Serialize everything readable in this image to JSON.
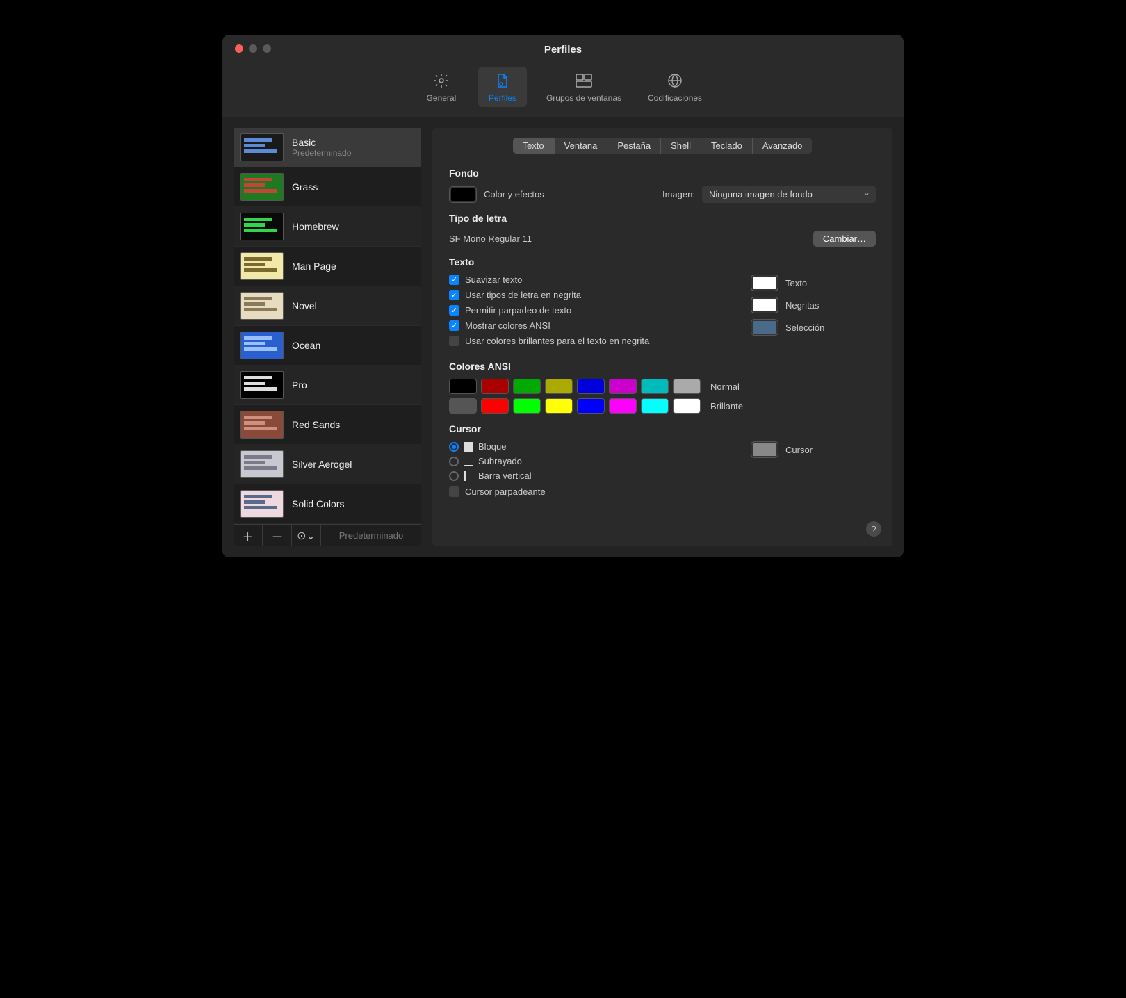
{
  "window": {
    "title": "Perfiles"
  },
  "toolbar": {
    "items": [
      {
        "label": "General"
      },
      {
        "label": "Perfiles"
      },
      {
        "label": "Grupos de ventanas"
      },
      {
        "label": "Codificaciones"
      }
    ],
    "active": 1
  },
  "sidebar": {
    "profiles": [
      {
        "name": "Basic",
        "sub": "Predeterminado",
        "bg": "#1a1a1a",
        "fg": "#5b8bd4"
      },
      {
        "name": "Grass",
        "bg": "#1f7a1f",
        "fg": "#c4443c"
      },
      {
        "name": "Homebrew",
        "bg": "#0a0a0a",
        "fg": "#2fd84a"
      },
      {
        "name": "Man Page",
        "bg": "#f2e9a8",
        "fg": "#7a6a2e"
      },
      {
        "name": "Novel",
        "bg": "#e8dcc0",
        "fg": "#8a7a5a"
      },
      {
        "name": "Ocean",
        "bg": "#2a5fd0",
        "fg": "#9ac0ff"
      },
      {
        "name": "Pro",
        "bg": "#000000",
        "fg": "#dddddd"
      },
      {
        "name": "Red Sands",
        "bg": "#8a4a3a",
        "fg": "#d09080"
      },
      {
        "name": "Silver Aerogel",
        "bg": "#c8c8d0",
        "fg": "#7a7a8a"
      },
      {
        "name": "Solid Colors",
        "bg": "#f0d8e0",
        "fg": "#5a6a8a"
      }
    ],
    "selected": 0,
    "footer_default": "Predeterminado"
  },
  "tabs": {
    "items": [
      "Texto",
      "Ventana",
      "Pestaña",
      "Shell",
      "Teclado",
      "Avanzado"
    ],
    "active": 0
  },
  "background": {
    "title": "Fondo",
    "well_color": "#000000",
    "color_effects": "Color y efectos",
    "image_label": "Imagen:",
    "image_select": "Ninguna imagen de fondo"
  },
  "font": {
    "title": "Tipo de letra",
    "current": "SF Mono Regular 11",
    "change_btn": "Cambiar…"
  },
  "text": {
    "title": "Texto",
    "checks": [
      {
        "label": "Suavizar texto",
        "on": true
      },
      {
        "label": "Usar tipos de letra en negrita",
        "on": true
      },
      {
        "label": "Permitir parpadeo de texto",
        "on": true
      },
      {
        "label": "Mostrar colores ANSI",
        "on": true
      },
      {
        "label": "Usar colores brillantes para el texto en negrita",
        "on": false
      }
    ],
    "wells": [
      {
        "label": "Texto",
        "color": "#ffffff"
      },
      {
        "label": "Negritas",
        "color": "#ffffff"
      },
      {
        "label": "Selección",
        "color": "#4a6a8a"
      }
    ]
  },
  "ansi": {
    "title": "Colores ANSI",
    "normal_label": "Normal",
    "bright_label": "Brillante",
    "normal": [
      "#000000",
      "#aa0000",
      "#00aa00",
      "#aaaa00",
      "#0000dd",
      "#cc00cc",
      "#00bbbb",
      "#aaaaaa"
    ],
    "bright": [
      "#555555",
      "#ff0000",
      "#00ff00",
      "#ffff00",
      "#0000ff",
      "#ff00ff",
      "#00ffff",
      "#ffffff"
    ]
  },
  "cursor": {
    "title": "Cursor",
    "options": [
      {
        "label": "Bloque"
      },
      {
        "label": "Subrayado"
      },
      {
        "label": "Barra vertical"
      }
    ],
    "selected": 0,
    "blink_label": "Cursor parpadeante",
    "blink_on": false,
    "well_label": "Cursor",
    "well_color": "#888888"
  }
}
